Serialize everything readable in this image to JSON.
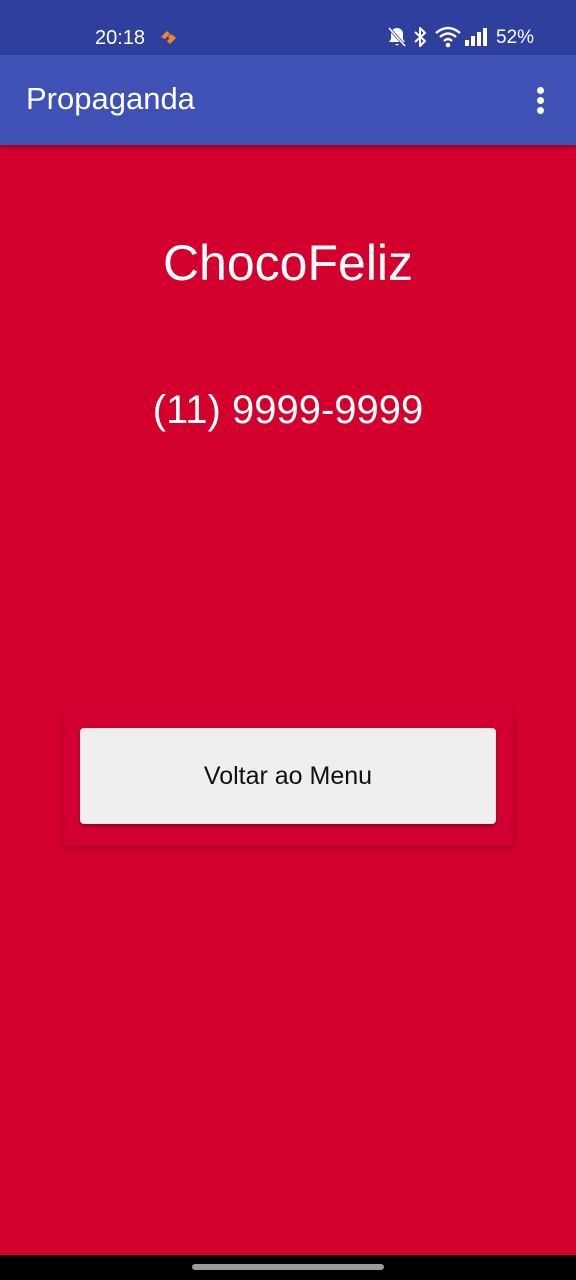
{
  "status_bar": {
    "time": "20:18",
    "battery": "52%",
    "icons": [
      "app-notification-icon",
      "bell-off-icon",
      "bluetooth-icon",
      "wifi-icon",
      "signal-icon"
    ]
  },
  "app_bar": {
    "title": "Propaganda",
    "menu_icon": "more-vert-icon"
  },
  "content": {
    "brand": "ChocoFeliz",
    "phone": "(11) 9999-9999",
    "back_button_label": "Voltar ao Menu"
  },
  "colors": {
    "status_bar": "#2e3f9d",
    "app_bar": "#3f51b5",
    "background": "#d3002d",
    "button": "#efefef",
    "accent": "#f4842c"
  }
}
